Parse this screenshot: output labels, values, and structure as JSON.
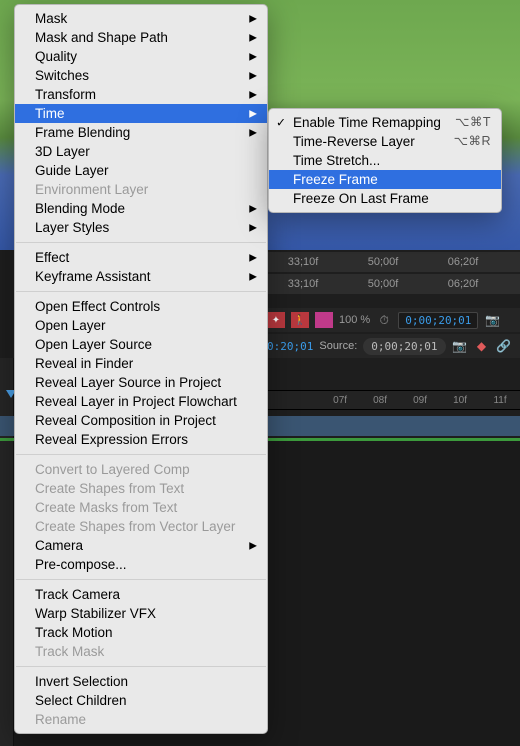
{
  "contextMenu": {
    "items": [
      {
        "label": "Mask",
        "arrow": true
      },
      {
        "label": "Mask and Shape Path",
        "arrow": true
      },
      {
        "label": "Quality",
        "arrow": true
      },
      {
        "label": "Switches",
        "arrow": true
      },
      {
        "label": "Transform",
        "arrow": true
      },
      {
        "label": "Time",
        "arrow": true,
        "highlighted": true
      },
      {
        "label": "Frame Blending",
        "arrow": true
      },
      {
        "label": "3D Layer"
      },
      {
        "label": "Guide Layer"
      },
      {
        "label": "Environment Layer",
        "disabled": true
      },
      {
        "label": "Blending Mode",
        "arrow": true
      },
      {
        "label": "Layer Styles",
        "arrow": true
      }
    ],
    "group2": [
      {
        "label": "Effect",
        "arrow": true
      },
      {
        "label": "Keyframe Assistant",
        "arrow": true
      }
    ],
    "group3": [
      {
        "label": "Open Effect Controls"
      },
      {
        "label": "Open Layer"
      },
      {
        "label": "Open Layer Source"
      },
      {
        "label": "Reveal in Finder"
      },
      {
        "label": "Reveal Layer Source in Project"
      },
      {
        "label": "Reveal Layer in Project Flowchart"
      },
      {
        "label": "Reveal Composition in Project"
      },
      {
        "label": "Reveal Expression Errors"
      }
    ],
    "group4": [
      {
        "label": "Convert to Layered Comp",
        "disabled": true
      },
      {
        "label": "Create Shapes from Text",
        "disabled": true
      },
      {
        "label": "Create Masks from Text",
        "disabled": true
      },
      {
        "label": "Create Shapes from Vector Layer",
        "disabled": true
      },
      {
        "label": "Camera",
        "arrow": true
      },
      {
        "label": "Pre-compose..."
      }
    ],
    "group5": [
      {
        "label": "Track Camera"
      },
      {
        "label": "Warp Stabilizer VFX"
      },
      {
        "label": "Track Motion"
      },
      {
        "label": "Track Mask",
        "disabled": true
      }
    ],
    "group6": [
      {
        "label": "Invert Selection"
      },
      {
        "label": "Select Children"
      },
      {
        "label": "Rename",
        "disabled": true
      }
    ]
  },
  "submenu": {
    "items": [
      {
        "label": "Enable Time Remapping",
        "checked": true,
        "shortcut": "⌥⌘T"
      },
      {
        "label": "Time-Reverse Layer",
        "shortcut": "⌥⌘R"
      },
      {
        "label": "Time Stretch..."
      },
      {
        "label": "Freeze Frame",
        "highlighted": true
      },
      {
        "label": "Freeze On Last Frame"
      }
    ]
  },
  "timelineHeader1": {
    "t1": "33;10f",
    "t2": "50;00f",
    "t3": "06;20f"
  },
  "timelineHeader2": {
    "t1": "33;10f",
    "t2": "50;00f",
    "t3": "06;20f"
  },
  "toolbar": {
    "zoom": "100 %",
    "timecode": "0;00;20;01",
    "clock": "⏱"
  },
  "toolbar2": {
    "time": "0:20;01",
    "sourceLabel": "Source:",
    "sourceTime": "0;00;20;01"
  },
  "ruler": {
    "t1": "07f",
    "t2": "08f",
    "t3": "09f",
    "t4": "10f",
    "t5": "11f"
  }
}
